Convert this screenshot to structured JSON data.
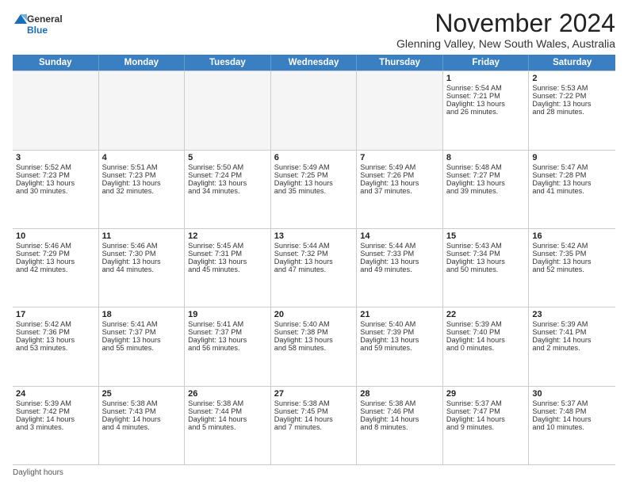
{
  "logo": {
    "general": "General",
    "blue": "Blue"
  },
  "title": "November 2024",
  "subtitle": "Glenning Valley, New South Wales, Australia",
  "days": [
    "Sunday",
    "Monday",
    "Tuesday",
    "Wednesday",
    "Thursday",
    "Friday",
    "Saturday"
  ],
  "footer": "Daylight hours",
  "weeks": [
    [
      {
        "day": "",
        "info": ""
      },
      {
        "day": "",
        "info": ""
      },
      {
        "day": "",
        "info": ""
      },
      {
        "day": "",
        "info": ""
      },
      {
        "day": "",
        "info": ""
      },
      {
        "day": "1",
        "info": "Sunrise: 5:54 AM\nSunset: 7:21 PM\nDaylight: 13 hours\nand 26 minutes."
      },
      {
        "day": "2",
        "info": "Sunrise: 5:53 AM\nSunset: 7:22 PM\nDaylight: 13 hours\nand 28 minutes."
      }
    ],
    [
      {
        "day": "3",
        "info": "Sunrise: 5:52 AM\nSunset: 7:23 PM\nDaylight: 13 hours\nand 30 minutes."
      },
      {
        "day": "4",
        "info": "Sunrise: 5:51 AM\nSunset: 7:23 PM\nDaylight: 13 hours\nand 32 minutes."
      },
      {
        "day": "5",
        "info": "Sunrise: 5:50 AM\nSunset: 7:24 PM\nDaylight: 13 hours\nand 34 minutes."
      },
      {
        "day": "6",
        "info": "Sunrise: 5:49 AM\nSunset: 7:25 PM\nDaylight: 13 hours\nand 35 minutes."
      },
      {
        "day": "7",
        "info": "Sunrise: 5:49 AM\nSunset: 7:26 PM\nDaylight: 13 hours\nand 37 minutes."
      },
      {
        "day": "8",
        "info": "Sunrise: 5:48 AM\nSunset: 7:27 PM\nDaylight: 13 hours\nand 39 minutes."
      },
      {
        "day": "9",
        "info": "Sunrise: 5:47 AM\nSunset: 7:28 PM\nDaylight: 13 hours\nand 41 minutes."
      }
    ],
    [
      {
        "day": "10",
        "info": "Sunrise: 5:46 AM\nSunset: 7:29 PM\nDaylight: 13 hours\nand 42 minutes."
      },
      {
        "day": "11",
        "info": "Sunrise: 5:46 AM\nSunset: 7:30 PM\nDaylight: 13 hours\nand 44 minutes."
      },
      {
        "day": "12",
        "info": "Sunrise: 5:45 AM\nSunset: 7:31 PM\nDaylight: 13 hours\nand 45 minutes."
      },
      {
        "day": "13",
        "info": "Sunrise: 5:44 AM\nSunset: 7:32 PM\nDaylight: 13 hours\nand 47 minutes."
      },
      {
        "day": "14",
        "info": "Sunrise: 5:44 AM\nSunset: 7:33 PM\nDaylight: 13 hours\nand 49 minutes."
      },
      {
        "day": "15",
        "info": "Sunrise: 5:43 AM\nSunset: 7:34 PM\nDaylight: 13 hours\nand 50 minutes."
      },
      {
        "day": "16",
        "info": "Sunrise: 5:42 AM\nSunset: 7:35 PM\nDaylight: 13 hours\nand 52 minutes."
      }
    ],
    [
      {
        "day": "17",
        "info": "Sunrise: 5:42 AM\nSunset: 7:36 PM\nDaylight: 13 hours\nand 53 minutes."
      },
      {
        "day": "18",
        "info": "Sunrise: 5:41 AM\nSunset: 7:37 PM\nDaylight: 13 hours\nand 55 minutes."
      },
      {
        "day": "19",
        "info": "Sunrise: 5:41 AM\nSunset: 7:37 PM\nDaylight: 13 hours\nand 56 minutes."
      },
      {
        "day": "20",
        "info": "Sunrise: 5:40 AM\nSunset: 7:38 PM\nDaylight: 13 hours\nand 58 minutes."
      },
      {
        "day": "21",
        "info": "Sunrise: 5:40 AM\nSunset: 7:39 PM\nDaylight: 13 hours\nand 59 minutes."
      },
      {
        "day": "22",
        "info": "Sunrise: 5:39 AM\nSunset: 7:40 PM\nDaylight: 14 hours\nand 0 minutes."
      },
      {
        "day": "23",
        "info": "Sunrise: 5:39 AM\nSunset: 7:41 PM\nDaylight: 14 hours\nand 2 minutes."
      }
    ],
    [
      {
        "day": "24",
        "info": "Sunrise: 5:39 AM\nSunset: 7:42 PM\nDaylight: 14 hours\nand 3 minutes."
      },
      {
        "day": "25",
        "info": "Sunrise: 5:38 AM\nSunset: 7:43 PM\nDaylight: 14 hours\nand 4 minutes."
      },
      {
        "day": "26",
        "info": "Sunrise: 5:38 AM\nSunset: 7:44 PM\nDaylight: 14 hours\nand 5 minutes."
      },
      {
        "day": "27",
        "info": "Sunrise: 5:38 AM\nSunset: 7:45 PM\nDaylight: 14 hours\nand 7 minutes."
      },
      {
        "day": "28",
        "info": "Sunrise: 5:38 AM\nSunset: 7:46 PM\nDaylight: 14 hours\nand 8 minutes."
      },
      {
        "day": "29",
        "info": "Sunrise: 5:37 AM\nSunset: 7:47 PM\nDaylight: 14 hours\nand 9 minutes."
      },
      {
        "day": "30",
        "info": "Sunrise: 5:37 AM\nSunset: 7:48 PM\nDaylight: 14 hours\nand 10 minutes."
      }
    ]
  ]
}
